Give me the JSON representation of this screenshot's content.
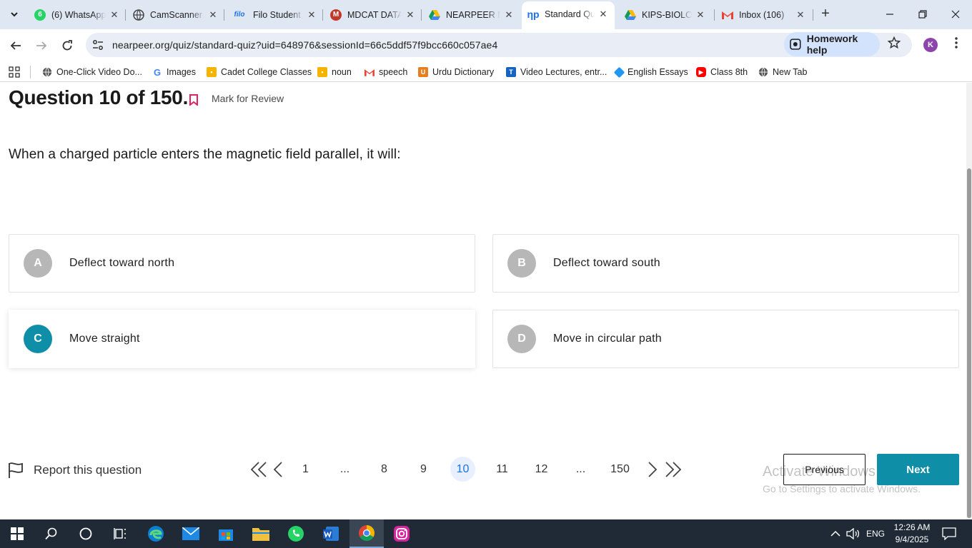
{
  "browser": {
    "tabs": [
      {
        "title": "(6) WhatsApp",
        "icon": "whatsapp-icon",
        "color": "#25d366",
        "active": false
      },
      {
        "title": "CamScanner",
        "icon": "globe-icon",
        "color": "#5f6368",
        "active": false
      },
      {
        "title": "Filo Student",
        "icon": "filo-icon",
        "color": "#1a73e8",
        "active": false
      },
      {
        "title": "MDCAT DATA",
        "icon": "mdcat-icon",
        "color": "#c0392b",
        "active": false
      },
      {
        "title": "NEARPEER N",
        "icon": "google-drive-icon",
        "color": "#1a73e8",
        "active": false
      },
      {
        "title": "Standard Qu",
        "icon": "nearpeer-icon",
        "color": "#1a73e8",
        "active": true
      },
      {
        "title": "KIPS-BIOLO",
        "icon": "google-drive-icon",
        "color": "#1a73e8",
        "active": false
      },
      {
        "title": "Inbox (106)",
        "icon": "gmail-icon",
        "color": "#ea4335",
        "active": false
      }
    ],
    "url": "nearpeer.org/quiz/standard-quiz?uid=648976&sessionId=66c5ddf57f9bcc660c057ae4",
    "homework_help": "Homework help",
    "profile_initial": "K",
    "bookmarks": [
      {
        "label": "One-Click Video Do...",
        "icon": "globe-icon"
      },
      {
        "label": "Images",
        "icon": "google-icon"
      },
      {
        "label": "Cadet College Classes",
        "icon": "classroom-icon"
      },
      {
        "label": "noun",
        "icon": "classroom-icon"
      },
      {
        "label": "speech",
        "icon": "gmail-icon"
      },
      {
        "label": "Urdu Dictionary",
        "icon": "dictionary-icon"
      },
      {
        "label": "Video Lectures, entr...",
        "icon": "video-lectures-icon"
      },
      {
        "label": "English Essays",
        "icon": "essays-icon"
      },
      {
        "label": "Class 8th",
        "icon": "youtube-icon"
      },
      {
        "label": "New Tab",
        "icon": "globe-icon"
      }
    ]
  },
  "quiz": {
    "title": "Question 10 of 150.",
    "mark_review": "Mark for Review",
    "question": "When a charged particle enters the magnetic field parallel, it will:",
    "options": [
      {
        "letter": "A",
        "text": "Deflect toward north",
        "selected": false
      },
      {
        "letter": "B",
        "text": "Deflect toward south",
        "selected": false
      },
      {
        "letter": "C",
        "text": "Move straight",
        "selected": true
      },
      {
        "letter": "D",
        "text": "Move in circular path",
        "selected": false
      }
    ],
    "accent_color": "#0f8ea8",
    "report": "Report this question",
    "pagination": [
      "1",
      "...",
      "8",
      "9",
      "10",
      "11",
      "12",
      "...",
      "150"
    ],
    "current_page": "10",
    "previous": "Previous",
    "next": "Next"
  },
  "watermark": {
    "line1": "Activate Windows",
    "line2": "Go to Settings to activate Windows."
  },
  "taskbar": {
    "language": "ENG",
    "time": "12:26 AM",
    "date": "9/4/2025"
  }
}
